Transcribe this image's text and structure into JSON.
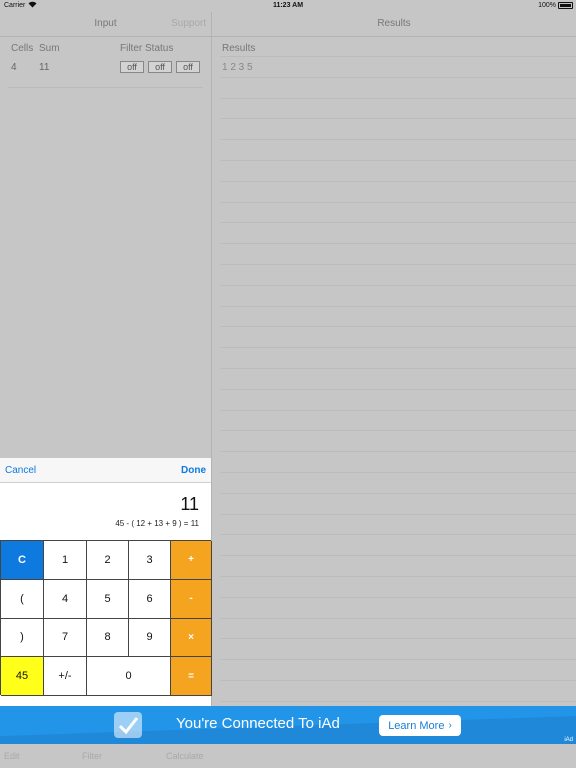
{
  "status_bar": {
    "carrier": "Carrier",
    "time": "11:23 AM",
    "battery": "100%"
  },
  "left": {
    "title": "Input",
    "support_label": "Support",
    "columns": [
      "Cells",
      "Sum",
      "Filter Status"
    ],
    "row": {
      "cells": "4",
      "sum": "11",
      "filters": [
        "off",
        "off",
        "off"
      ]
    }
  },
  "right": {
    "title": "Results",
    "header": "Results",
    "value": "1 2 3 5"
  },
  "keypad": {
    "cancel_label": "Cancel",
    "done_label": "Done",
    "display": "11",
    "expression": "45 - ( 12 + 13 + 9 ) = 11",
    "keys": [
      "C",
      "1",
      "2",
      "3",
      "+",
      "(",
      "4",
      "5",
      "6",
      "-",
      ")",
      "7",
      "8",
      "9",
      "×",
      "45",
      "+/-",
      "0",
      "="
    ]
  },
  "ad": {
    "text": "You're Connected To iAd",
    "button": "Learn More",
    "badge": "iAd"
  },
  "toolbar": {
    "edit": "Edit",
    "filter": "Filter",
    "calculate": "Calculate"
  },
  "colors": {
    "accent_blue": "#0e7ae0",
    "operator_orange": "#f4a41f",
    "highlight_yellow": "#ffff19",
    "ad_blue": "#2395e8"
  }
}
